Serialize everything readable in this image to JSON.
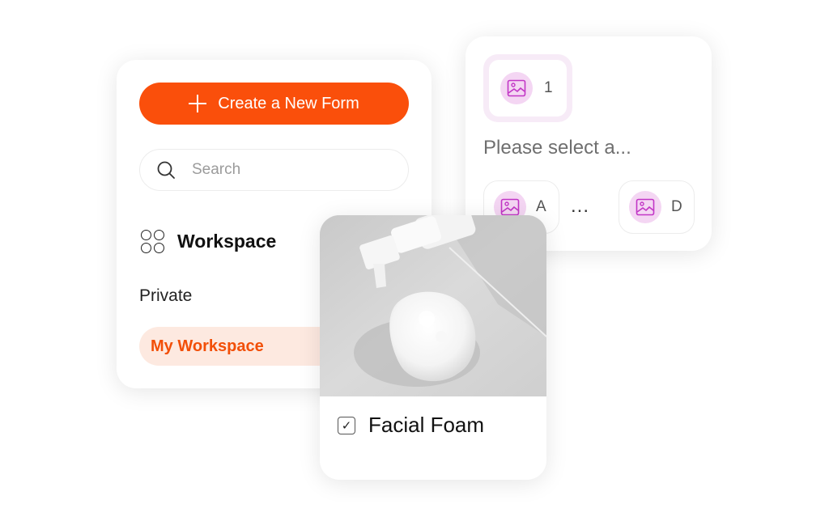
{
  "sidebar": {
    "create_button": "Create a New Form",
    "search_placeholder": "Search",
    "workspace_heading": "Workspace",
    "private_label": "Private",
    "active_item": "My Workspace"
  },
  "options_card": {
    "first_option": "1",
    "prompt": "Please select a...",
    "options": [
      {
        "letter": "A"
      },
      {
        "letter": "D"
      }
    ],
    "ellipsis": "..."
  },
  "product_card": {
    "name": "Facial Foam",
    "checked": true,
    "check_mark": "✓"
  },
  "colors": {
    "accent": "#fa4f0b",
    "accent_light": "#fde9e0",
    "image_badge": "#f4d6f3",
    "image_icon": "#c236c6"
  },
  "icons": [
    "plus-icon",
    "search-icon",
    "workspace-grid-icon",
    "image-icon",
    "checkbox-icon"
  ]
}
